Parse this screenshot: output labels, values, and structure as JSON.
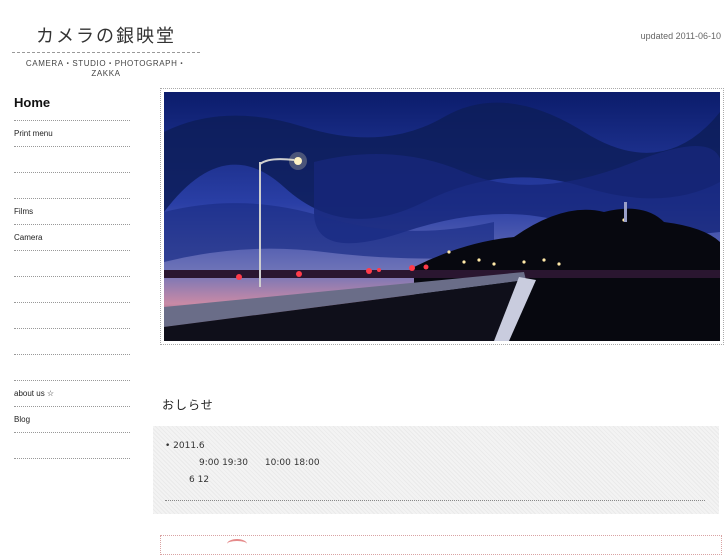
{
  "header": {
    "logo_title": "カメラの銀映堂",
    "logo_subtitle": "CAMERA・STUDIO・PHOTOGRAPH・ZAKKA",
    "updated": "updated 2011-06-10"
  },
  "nav": {
    "home": "Home",
    "items": [
      {
        "label": "Print menu"
      },
      {
        "label": ""
      },
      {
        "label": ""
      },
      {
        "label": "Films"
      },
      {
        "label": "Camera"
      },
      {
        "label": ""
      },
      {
        "label": ""
      },
      {
        "label": ""
      },
      {
        "label": ""
      },
      {
        "label": ""
      },
      {
        "label": "about us ☆"
      },
      {
        "label": "Blog"
      },
      {
        "label": ""
      }
    ]
  },
  "notice": {
    "title": "おしらせ",
    "date": "• 2011.6",
    "hours_1": "9:00  19:30",
    "hours_2": "10:00  18:00",
    "closed": "6 12"
  },
  "colors": {
    "sky_top": "#0b1c6b",
    "sky_mid": "#2a3fa6",
    "horizon": "#c98aa6",
    "ground": "#0a0a1a"
  }
}
